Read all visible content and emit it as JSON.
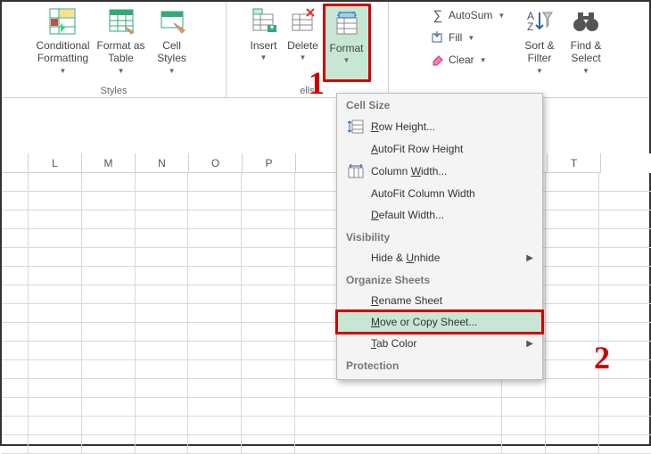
{
  "ribbon": {
    "styles": {
      "label": "Styles",
      "conditional": "Conditional\nFormatting",
      "formatAs": "Format as\nTable",
      "cellStyles": "Cell\nStyles"
    },
    "cells": {
      "label": "ells",
      "insert": "Insert",
      "delete": "Delete",
      "format": "Format"
    },
    "editing": {
      "autosum": "AutoSum",
      "fill": "Fill",
      "clear": "Clear",
      "sort": "Sort &\nFilter",
      "find": "Find &\nSelect"
    }
  },
  "columns": [
    "L",
    "M",
    "N",
    "O",
    "P",
    "",
    "",
    "",
    "",
    "",
    "T"
  ],
  "menu": {
    "s1": "Cell Size",
    "rowHeight": "Row Height...",
    "autofitRow": "AutoFit Row Height",
    "colWidth": "Column Width...",
    "autofitCol": "AutoFit Column Width",
    "defWidth": "Default Width...",
    "s2": "Visibility",
    "hide": "Hide & Unhide",
    "s3": "Organize Sheets",
    "rename": "Rename Sheet",
    "move": "Move or Copy Sheet...",
    "tabColor": "Tab Color",
    "s4": "Protection"
  },
  "anno": {
    "one": "1",
    "two": "2"
  }
}
